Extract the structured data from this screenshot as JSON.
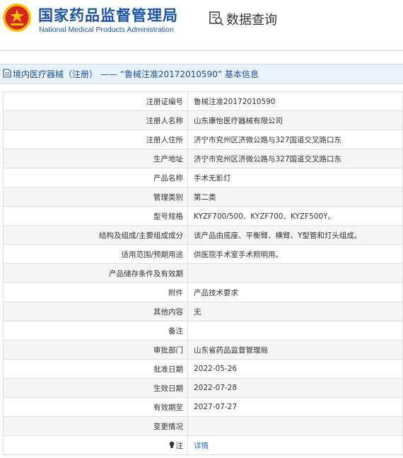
{
  "header": {
    "org_name_cn": "国家药品监督管理局",
    "org_name_en": "National Medical Products Administration",
    "query_title": "数据查询",
    "logo_icon": "nmpa-emblem-icon",
    "query_icon": "data-query-icon"
  },
  "breadcrumb": {
    "text": "境内医疗器械（注册） —— “鲁械注准20172010590” 基本信息",
    "icon": "document-icon"
  },
  "rows": [
    {
      "label": "注册证编号",
      "value": "鲁械注准20172010590"
    },
    {
      "label": "注册人名称",
      "value": "山东康怡医疗器械有限公司"
    },
    {
      "label": "注册人住所",
      "value": "济宁市兖州区济微公路与327国道交叉路口东"
    },
    {
      "label": "生产地址",
      "value": "济宁市兖州区济微公路与327国道交叉路口东"
    },
    {
      "label": "产品名称",
      "value": "手术无影灯"
    },
    {
      "label": "管理类别",
      "value": "第二类"
    },
    {
      "label": "型号规格",
      "value": "KYZF700/500、KYZF700、KYZF500Y。"
    },
    {
      "label": "结构及组成/主要组成成分",
      "value": "该产品由底座、平衡臂、横臂、Y型管和灯头组成。"
    },
    {
      "label": "适用范围/预期用途",
      "value": "供医院手术室手术照明用。"
    },
    {
      "label": "产品储存条件及有效期",
      "value": ""
    },
    {
      "label": "附件",
      "value": "产品技术要求"
    },
    {
      "label": "其他内容",
      "value": "无"
    },
    {
      "label": "备注",
      "value": ""
    },
    {
      "label": "审批部门",
      "value": "山东省药品监督管理局"
    },
    {
      "label": "批准日期",
      "value": "2022-05-26"
    },
    {
      "label": "生效日期",
      "value": "2022-07-28"
    },
    {
      "label": "有效期至",
      "value": "2027-07-27"
    },
    {
      "label": "变更情况",
      "value": ""
    }
  ],
  "note_row": {
    "label": "注",
    "link_text": "详情",
    "icon": "lightbulb-icon"
  },
  "colors": {
    "brand_blue": "#1a53a8",
    "link_blue": "#2a6fc9",
    "emblem_red": "#d7261f",
    "emblem_gold": "#f2c200"
  }
}
